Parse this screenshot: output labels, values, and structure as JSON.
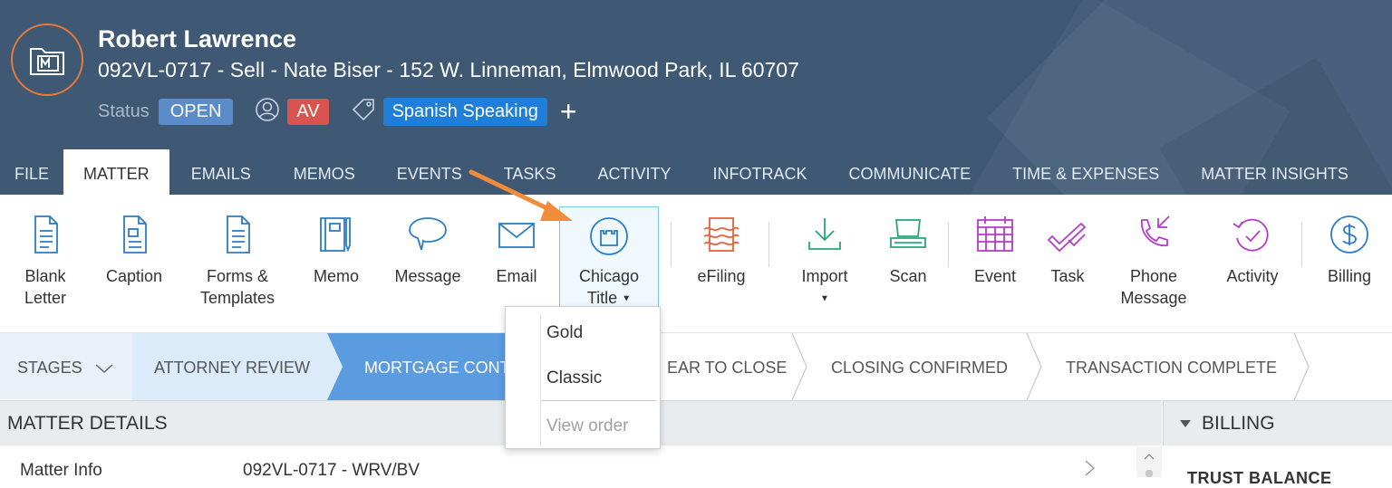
{
  "header": {
    "client_name": "Robert Lawrence",
    "matter_line": "092VL-0717 - Sell - Nate Biser - 152 W. Linneman, Elmwood Park, IL 60707",
    "status_label": "Status",
    "status_value": "OPEN",
    "attorney_initials": "AV",
    "tag": "Spanish Speaking",
    "add_symbol": "+",
    "colors": {
      "header_bg": "#3f5874",
      "open": "#5b8cc9",
      "av": "#d9534f",
      "tag": "#1f7fd8",
      "ring": "#e87a3a"
    }
  },
  "tabs": [
    {
      "label": "FILE"
    },
    {
      "label": "MATTER",
      "active": true
    },
    {
      "label": "EMAILS"
    },
    {
      "label": "MEMOS"
    },
    {
      "label": "EVENTS"
    },
    {
      "label": "TASKS"
    },
    {
      "label": "ACTIVITY"
    },
    {
      "label": "INFOTRACK"
    },
    {
      "label": "COMMUNICATE"
    },
    {
      "label": "TIME & EXPENSES"
    },
    {
      "label": "MATTER INSIGHTS"
    }
  ],
  "ribbon": {
    "blank_letter": {
      "line1": "Blank",
      "line2": "Letter",
      "icon": "document-icon"
    },
    "caption": {
      "line1": "Caption",
      "icon": "caption-document-icon"
    },
    "forms": {
      "line1": "Forms &",
      "line2": "Templates",
      "icon": "document-icon"
    },
    "memo": {
      "line1": "Memo",
      "icon": "notebook-icon"
    },
    "message": {
      "line1": "Message",
      "icon": "speech-bubble-icon"
    },
    "email": {
      "line1": "Email",
      "icon": "envelope-icon"
    },
    "chicago": {
      "line1": "Chicago",
      "line2": "Title",
      "icon": "chicago-title-icon"
    },
    "efiling": {
      "line1": "eFiling",
      "icon": "efiling-icon"
    },
    "import": {
      "line1": "Import",
      "icon": "download-icon"
    },
    "scan": {
      "line1": "Scan",
      "icon": "scanner-icon"
    },
    "event": {
      "line1": "Event",
      "icon": "calendar-icon"
    },
    "task": {
      "line1": "Task",
      "icon": "checkmark-icon"
    },
    "phone": {
      "line1": "Phone",
      "line2": "Message",
      "icon": "phone-icon"
    },
    "activity": {
      "line1": "Activity",
      "icon": "activity-icon"
    },
    "billing": {
      "line1": "Billing",
      "icon": "dollar-icon"
    }
  },
  "chicago_menu": {
    "items": [
      "Gold",
      "Classic"
    ],
    "disabled_item": "View order"
  },
  "stages": {
    "label": "STAGES",
    "items": [
      "ATTORNEY REVIEW",
      "MORTGAGE CONT",
      "EAR TO CLOSE",
      "CLOSING CONFIRMED",
      "TRANSACTION COMPLETE"
    ]
  },
  "details": {
    "title": "MATTER DETAILS",
    "row_label": "Matter Info",
    "row_value": "092VL-0717 - WRV/BV"
  },
  "billing_panel": {
    "title": "BILLING",
    "subtitle": "TRUST BALANCE"
  }
}
